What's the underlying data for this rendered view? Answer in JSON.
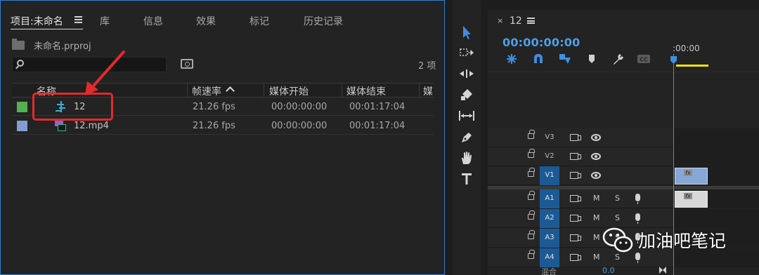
{
  "project_panel": {
    "tabs": [
      {
        "label": "项目:未命名"
      },
      {
        "label": "库"
      },
      {
        "label": "信息"
      },
      {
        "label": "效果"
      },
      {
        "label": "标记"
      },
      {
        "label": "历史记录"
      }
    ],
    "project_file": "未命名.prproj",
    "search_placeholder": "",
    "item_count": "2 项",
    "columns": [
      "名称",
      "帧速率",
      "媒体开始",
      "媒体结束",
      "媒"
    ],
    "rows": [
      {
        "label_color": "#55b04f",
        "name": "12",
        "frame_rate": "21.26 fps",
        "media_start": "00:00:00:00",
        "media_end": "00:01:17:04",
        "icon": "sequence-icon"
      },
      {
        "label_color": "#7f9fd1",
        "name": "12.mp4",
        "frame_rate": "21.26 fps",
        "media_start": "00:00:00:00",
        "media_end": "00:01:17:04",
        "icon": "video-clip-icon"
      }
    ]
  },
  "tools": [
    "selection-tool-icon",
    "track-select-tool-icon",
    "ripple-edit-tool-icon",
    "razor-tool-icon",
    "slip-tool-icon",
    "pen-tool-icon",
    "hand-tool-icon",
    "type-tool-icon"
  ],
  "timeline": {
    "sequence_name": "12",
    "close_glyph": "×",
    "timecode": "00:00:00:00",
    "ruler_time": ":00:00",
    "video_tracks": [
      "V3",
      "V2",
      "V1"
    ],
    "audio_tracks": [
      "A1",
      "A2",
      "A3",
      "A4"
    ],
    "mute_label": "M",
    "solo_label": "S",
    "clip_fx_label": "fx",
    "bottom_label": "混合",
    "bottom_value": "0.0",
    "accent_color": "#4aa0e6",
    "work_area_color": "#f2e313"
  },
  "watermark": {
    "text": "加油吧笔记"
  }
}
